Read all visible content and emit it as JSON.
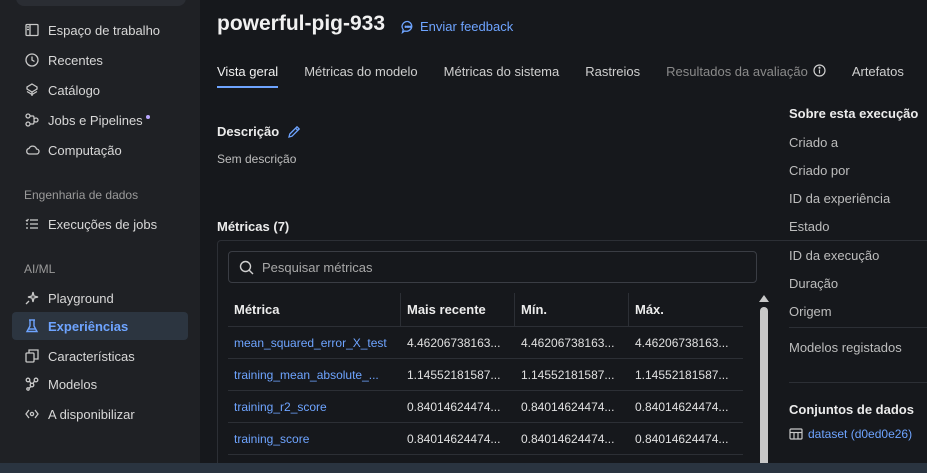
{
  "sidebar": {
    "items": [
      {
        "label": "Espaço de trabalho",
        "icon": "workspace-icon"
      },
      {
        "label": "Recentes",
        "icon": "clock-icon"
      },
      {
        "label": "Catálogo",
        "icon": "catalog-icon"
      },
      {
        "label": "Jobs e Pipelines",
        "icon": "workflow-icon"
      },
      {
        "label": "Computação",
        "icon": "cloud-icon"
      }
    ],
    "section_data_engineering": "Engenharia de dados",
    "data_engineering_items": [
      {
        "label": "Execuções de jobs",
        "icon": "list-icon"
      }
    ],
    "section_aiml": "AI/ML",
    "aiml_items": [
      {
        "label": "Playground",
        "icon": "sparkle-icon"
      },
      {
        "label": "Experiências",
        "icon": "flask-icon",
        "active": true
      },
      {
        "label": "Características",
        "icon": "features-icon"
      },
      {
        "label": "Modelos",
        "icon": "models-icon"
      },
      {
        "label": "A disponibilizar",
        "icon": "serving-icon"
      }
    ]
  },
  "header": {
    "run_name": "powerful-pig-933",
    "feedback_label": "Enviar feedback"
  },
  "tabs": [
    {
      "label": "Vista geral",
      "active": true
    },
    {
      "label": "Métricas do modelo"
    },
    {
      "label": "Métricas do sistema"
    },
    {
      "label": "Rastreios"
    },
    {
      "label": "Resultados da avaliação",
      "disabled": true
    },
    {
      "label": "Artefatos"
    }
  ],
  "description": {
    "label": "Descrição",
    "value": "Sem descrição"
  },
  "metrics": {
    "label": "Métricas (7)",
    "search_placeholder": "Pesquisar métricas",
    "columns": [
      "Métrica",
      "Mais recente",
      "Mín.",
      "Máx."
    ],
    "rows": [
      [
        "mean_squared_error_X_test",
        "4.46206738163...",
        "4.46206738163...",
        "4.46206738163..."
      ],
      [
        "training_mean_absolute_...",
        "1.14552181587...",
        "1.14552181587...",
        "1.14552181587..."
      ],
      [
        "training_r2_score",
        "0.84014624474...",
        "0.84014624474...",
        "0.84014624474..."
      ],
      [
        "training_score",
        "0.84014624474...",
        "0.84014624474...",
        "0.84014624474..."
      ]
    ]
  },
  "about": {
    "title": "Sobre esta execução",
    "items": [
      "Criado a",
      "Criado por",
      "ID da experiência",
      "Estado",
      "ID da execução",
      "Duração",
      "Origem"
    ],
    "registered_models": "Modelos registados",
    "datasets_title": "Conjuntos de dados",
    "dataset_link": "dataset (d0ed0e26)"
  },
  "colors": {
    "accent": "#6ea4ff",
    "background": "#16181c",
    "sidebar": "#1f2125"
  }
}
